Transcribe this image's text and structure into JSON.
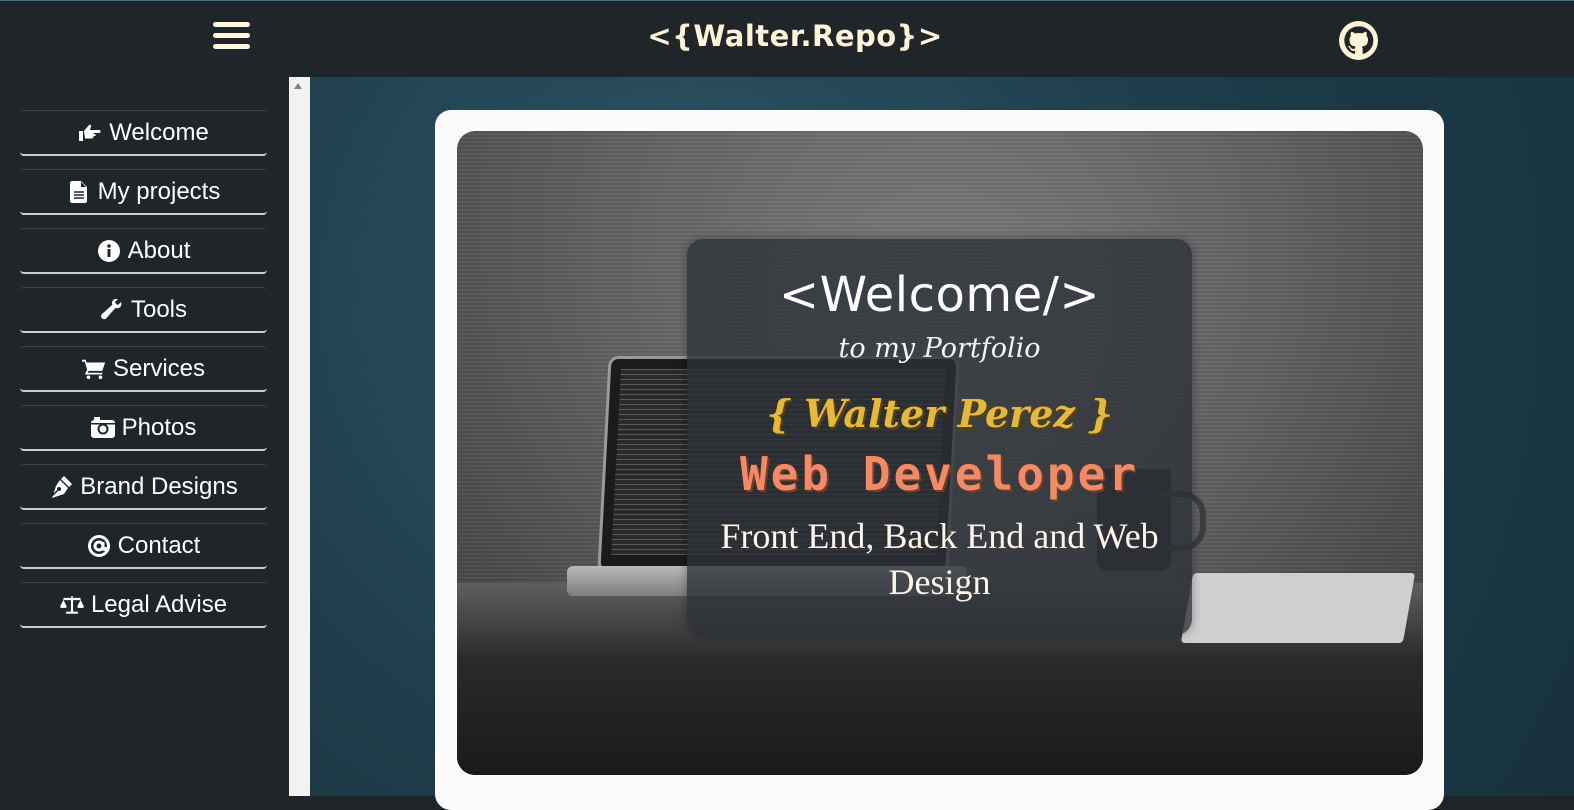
{
  "header": {
    "brand": "<{Walter.Repo}>",
    "menu_icon": "hamburger-menu-icon",
    "github_icon": "github-icon"
  },
  "sidebar": {
    "items": [
      {
        "label": "Welcome",
        "icon": "pointing-hand-icon"
      },
      {
        "label": "My projects",
        "icon": "document-icon"
      },
      {
        "label": "About",
        "icon": "info-circle-icon"
      },
      {
        "label": "Tools",
        "icon": "wrench-icon"
      },
      {
        "label": "Services",
        "icon": "shopping-cart-icon"
      },
      {
        "label": "Photos",
        "icon": "camera-icon"
      },
      {
        "label": "Brand Designs",
        "icon": "pen-nib-icon"
      },
      {
        "label": "Contact",
        "icon": "at-sign-icon"
      },
      {
        "label": "Legal Advise",
        "icon": "balance-scale-icon"
      }
    ]
  },
  "hero": {
    "title": "<Welcome/>",
    "subtitle": "to my Portfolio",
    "name": "{ Walter Perez }",
    "role": "Web Developer",
    "description": "Front End, Back End and Web Design"
  },
  "colors": {
    "topbar": "#20252a",
    "accent_cream": "#fff4d6",
    "name_gold": "#e5b83f",
    "role_coral": "#f08a68",
    "main_bg": "#1d3b48"
  }
}
